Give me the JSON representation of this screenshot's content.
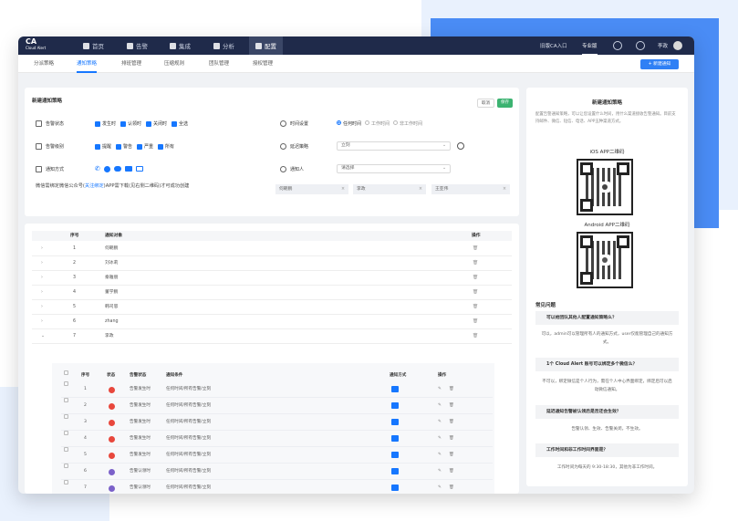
{
  "brand": {
    "name": "CA",
    "sub": "Cloud Alert"
  },
  "nav": [
    {
      "label": "首页",
      "icon": "home-icon"
    },
    {
      "label": "告警",
      "icon": "bell-icon"
    },
    {
      "label": "集成",
      "icon": "layers-icon"
    },
    {
      "label": "分析",
      "icon": "chart-icon"
    },
    {
      "label": "配置",
      "icon": "gear-icon"
    }
  ],
  "topright": {
    "entry": "旧版CA入口",
    "pro": "专业版",
    "user": "李政"
  },
  "tabs": [
    "分派策略",
    "通知策略",
    "排班管理",
    "压缩规则",
    "团队管理",
    "授权管理"
  ],
  "add_button": "+ 新建通知",
  "form": {
    "title": "新建通知策略",
    "cancel": "取消",
    "save": "保存",
    "alert_status_label": "告警状态",
    "alert_status_opts": [
      "发生时",
      "认领时",
      "关闭时",
      "全选"
    ],
    "severity_label": "告警级别",
    "severity_opts": [
      "提醒",
      "警告",
      "严重",
      "所有"
    ],
    "notify_label": "通知方式",
    "wechat_hint_prefix": "微信需绑定微信公众号(",
    "wechat_hint_link": "关注绑定",
    "wechat_hint_suffix": ")APP需下载(见右侧二维码)才可成功创建",
    "time_label": "时间设置",
    "time_opts": [
      "任何时间",
      "工作时间",
      "非工作时间"
    ],
    "delay_label": "延迟策略",
    "delay_value": "立刻",
    "notifier_label": "通知人",
    "notifier_placeholder": "请选择",
    "notifier_tags": [
      "何朝鹏",
      "李政",
      "王亚伟"
    ]
  },
  "table": {
    "headers": {
      "no": "序号",
      "target": "通知对象",
      "op": "操作"
    },
    "rows": [
      {
        "no": "1",
        "name": "何朝鹏"
      },
      {
        "no": "2",
        "name": "刘冰莉"
      },
      {
        "no": "3",
        "name": "秦雅丽"
      },
      {
        "no": "4",
        "name": "董学鹏"
      },
      {
        "no": "5",
        "name": "韩司思"
      },
      {
        "no": "6",
        "name": "zhang"
      },
      {
        "no": "7",
        "name": "李政"
      }
    ]
  },
  "subtable": {
    "headers": {
      "no": "序号",
      "status": "状态",
      "alert_status": "告警状态",
      "condition": "通知条件",
      "method": "通知方式",
      "op": "操作"
    },
    "rows": [
      {
        "no": "1",
        "color": "#e8473c",
        "status": "告警发生时",
        "cond": "任何时间/所有告警/立刻",
        "icon": "mail-icon"
      },
      {
        "no": "2",
        "color": "#e8473c",
        "status": "告警发生时",
        "cond": "任何时间/所有告警/立刻",
        "icon": "sms-icon"
      },
      {
        "no": "3",
        "color": "#e8473c",
        "status": "告警发生时",
        "cond": "任何时间/所有告警/立刻",
        "icon": "wechat-icon"
      },
      {
        "no": "4",
        "color": "#e8473c",
        "status": "告警发生时",
        "cond": "任何时间/所有告警/立刻",
        "icon": "app-icon"
      },
      {
        "no": "5",
        "color": "#e8473c",
        "status": "告警发生时",
        "cond": "任何时间/所有告警/立刻",
        "icon": "phone-icon"
      },
      {
        "no": "6",
        "color": "#7b61c9",
        "status": "告警认领时",
        "cond": "任何时间/所有告警/立刻",
        "icon": "sms-icon"
      },
      {
        "no": "7",
        "color": "#7b61c9",
        "status": "告警认领时",
        "cond": "任何时间/所有告警/立刻",
        "icon": "app-icon"
      }
    ]
  },
  "sidebar": {
    "title": "新建通知策略",
    "desc": "配置告警通知策略，可以让您设置什么时间，用什么渠道接收告警通知。目前支持邮件、微信、短信、电话、APP五种渠道方式。",
    "ios": "iOS APP二维码",
    "android": "Android APP二维码",
    "faq_title": "常见问题",
    "faq": [
      {
        "q": "可以给团队其他人配置通知策略么？",
        "a": "可以，admin可以管理所有人的通知方式，user仅能管理自己的通知方式。"
      },
      {
        "q": "1个 Cloud Alert 账号可以绑定多个微信么？",
        "a": "不可以，绑定微信是个人行为，需在个人中心界面绑定，绑定后可以启动微信通知。"
      },
      {
        "q": "延迟通知告警被认领后是否还会生效？",
        "a": "告警认领、生效、告警关闭，不生效。"
      },
      {
        "q": "工作时间和非工作时间界面是？",
        "a": "工作时间为每天的 9:30-18:30，其他为非工作时间。"
      }
    ]
  }
}
